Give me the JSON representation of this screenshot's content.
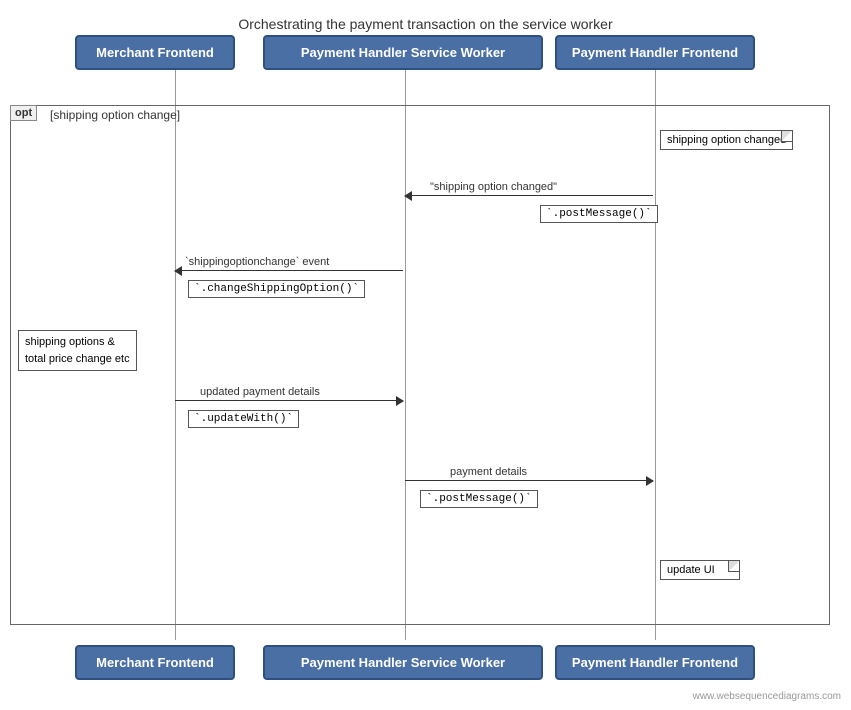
{
  "title": "Orchestrating the payment transaction on the service worker",
  "actors": {
    "merchant": "Merchant Frontend",
    "service": "Payment Handler Service Worker",
    "payment": "Payment Handler Frontend"
  },
  "opt": {
    "label": "opt",
    "condition": "[shipping option change]"
  },
  "notes": {
    "shipping_option_changed": "shipping option changed",
    "update_ui": "update UI"
  },
  "side_note": "shipping options &\ntotal price change etc",
  "messages": [
    {
      "id": "msg1",
      "text": "\"shipping option changed\""
    },
    {
      "id": "msg2",
      "text": "`shippingoptionchange` event"
    },
    {
      "id": "msg3",
      "text": "updated payment details"
    },
    {
      "id": "msg4",
      "text": "payment details"
    }
  ],
  "methods": [
    {
      "id": "m1",
      "text": "`.postMessage()`"
    },
    {
      "id": "m2",
      "text": "`.changeShippingOption()`"
    },
    {
      "id": "m3",
      "text": "`.updateWith()`"
    },
    {
      "id": "m4",
      "text": "`.postMessage()`"
    }
  ],
  "watermark": "www.websequencediagrams.com"
}
